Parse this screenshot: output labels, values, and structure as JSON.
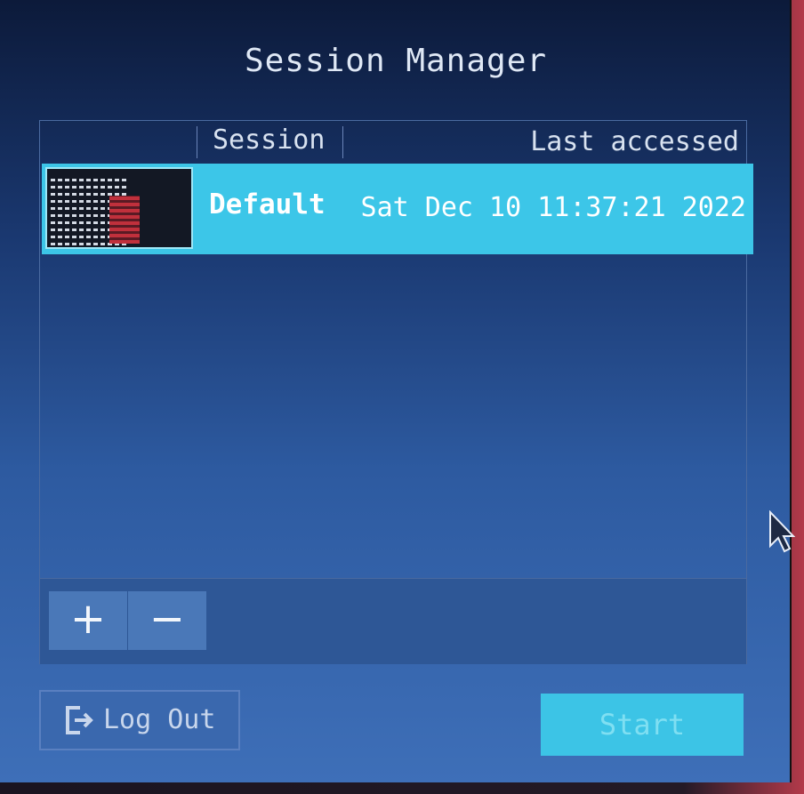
{
  "window": {
    "title": "Session Manager"
  },
  "list": {
    "columns": {
      "session": "Session",
      "last_accessed": "Last accessed"
    },
    "rows": [
      {
        "name": "Default",
        "last_accessed": "Sat Dec 10 11:37:21 2022",
        "selected": true
      }
    ],
    "toolbar": {
      "add_label": "+",
      "remove_label": "−"
    }
  },
  "footer": {
    "logout_label": "Log Out",
    "start_label": "Start"
  },
  "colors": {
    "selection": "#3cc6e8",
    "window_top": "#0c1a3a",
    "window_bottom": "#3e6fb8"
  },
  "icons": {
    "logout": "logout-icon",
    "cursor": "mouse-pointer-icon"
  }
}
